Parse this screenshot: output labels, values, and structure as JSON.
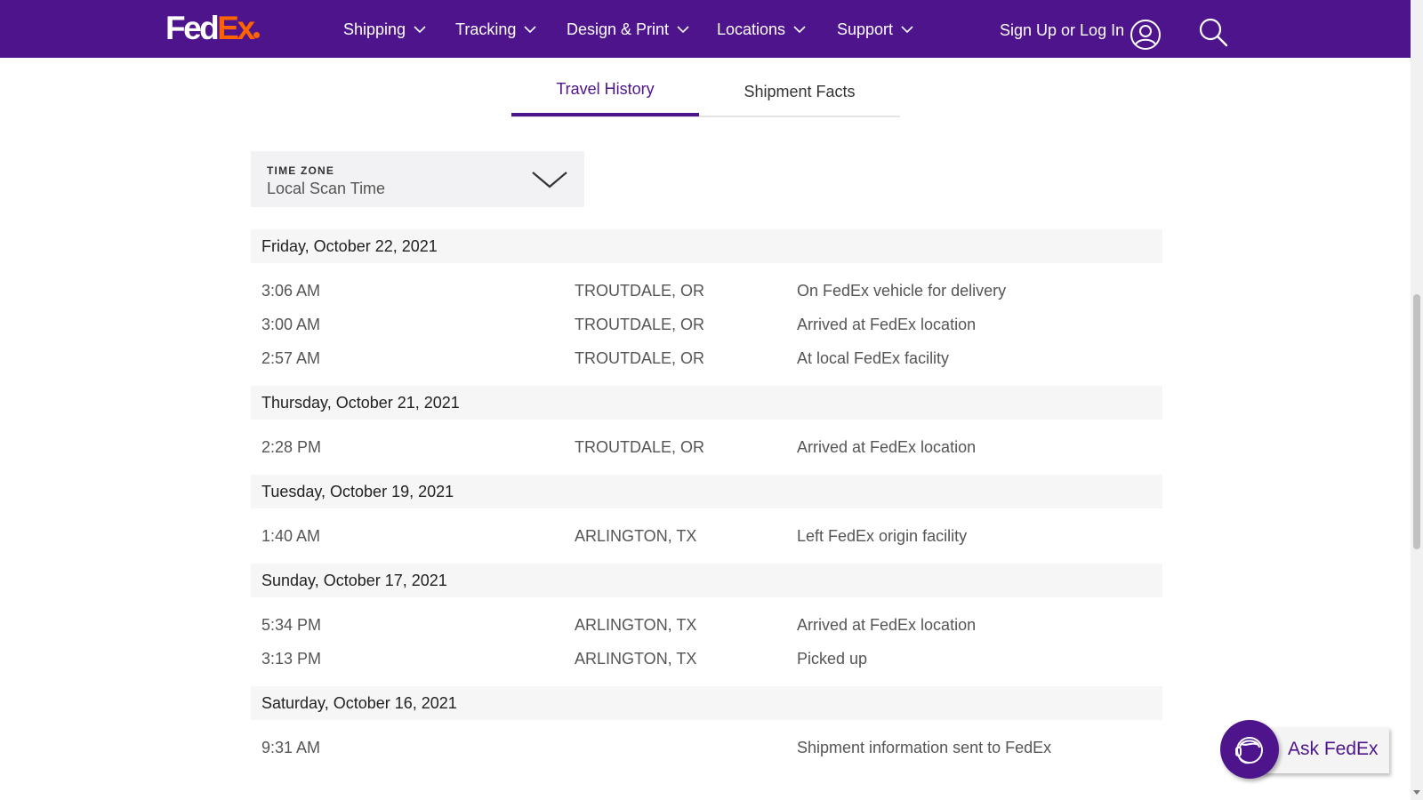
{
  "header": {
    "logo": {
      "fed": "Fed",
      "ex": "Ex"
    },
    "nav": [
      {
        "label": "Shipping"
      },
      {
        "label": "Tracking"
      },
      {
        "label": "Design & Print"
      },
      {
        "label": "Locations"
      },
      {
        "label": "Support"
      }
    ],
    "signin_label": "Sign Up or Log In"
  },
  "tabs": [
    {
      "label": "Travel History",
      "active": true
    },
    {
      "label": "Shipment Facts",
      "active": false
    }
  ],
  "timezone": {
    "label": "TIME ZONE",
    "value": "Local Scan Time"
  },
  "history": [
    {
      "date": "Friday, October 22, 2021",
      "events": [
        {
          "time": "3:06 AM",
          "location": "TROUTDALE, OR",
          "status": "On FedEx vehicle for delivery"
        },
        {
          "time": "3:00 AM",
          "location": "TROUTDALE, OR",
          "status": "Arrived at FedEx location"
        },
        {
          "time": "2:57 AM",
          "location": "TROUTDALE, OR",
          "status": "At local FedEx facility"
        }
      ]
    },
    {
      "date": "Thursday, October 21, 2021",
      "events": [
        {
          "time": "2:28 PM",
          "location": "TROUTDALE, OR",
          "status": "Arrived at FedEx location"
        }
      ]
    },
    {
      "date": "Tuesday, October 19, 2021",
      "events": [
        {
          "time": "1:40 AM",
          "location": "ARLINGTON, TX",
          "status": "Left FedEx origin facility"
        }
      ]
    },
    {
      "date": "Sunday, October 17, 2021",
      "events": [
        {
          "time": "5:34 PM",
          "location": "ARLINGTON, TX",
          "status": "Arrived at FedEx location"
        },
        {
          "time": "3:13 PM",
          "location": "ARLINGTON, TX",
          "status": "Picked up"
        }
      ]
    },
    {
      "date": "Saturday, October 16, 2021",
      "events": [
        {
          "time": "9:31 AM",
          "location": "",
          "status": "Shipment information sent to FedEx"
        }
      ]
    }
  ],
  "ask_fedex": {
    "label": "Ask FedEx"
  },
  "colors": {
    "brand_purple": "#4d148c",
    "brand_orange": "#ff6200"
  },
  "icons": [
    "chevron-down-icon",
    "user-icon",
    "search-icon",
    "headset-icon"
  ]
}
